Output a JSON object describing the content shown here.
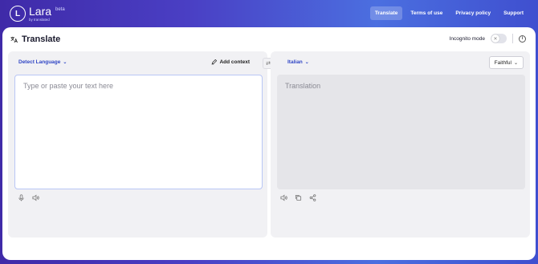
{
  "header": {
    "logo_letter": "L",
    "logo_name": "Lara",
    "logo_sub": "by translated",
    "beta": "beta",
    "nav": [
      {
        "label": "Translate",
        "active": true
      },
      {
        "label": "Terms of use",
        "active": false
      },
      {
        "label": "Privacy policy",
        "active": false
      },
      {
        "label": "Support",
        "active": false
      }
    ]
  },
  "page": {
    "title": "Translate",
    "incognito_label": "Incognito mode",
    "incognito_enabled": false
  },
  "source": {
    "language": "Detect Language",
    "add_context": "Add context",
    "placeholder": "Type or paste your text here"
  },
  "target": {
    "language": "Italian",
    "style": "Faithful",
    "placeholder": "Translation"
  },
  "colors": {
    "accent": "#3046c5",
    "header_gradient_start": "#3f2aa8",
    "header_gradient_end": "#4b6fe0"
  }
}
